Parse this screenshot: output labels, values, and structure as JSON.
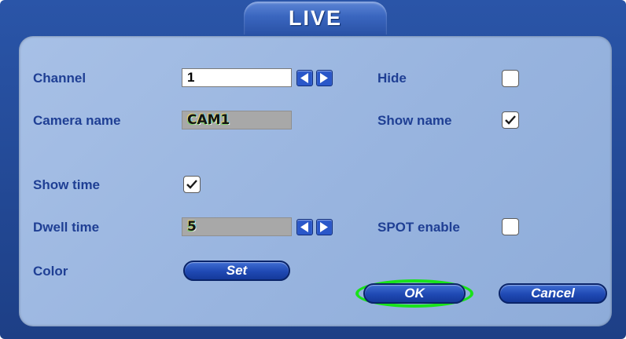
{
  "window": {
    "title": "LIVE"
  },
  "form": {
    "channel": {
      "label": "Channel",
      "value": "1"
    },
    "camera_name": {
      "label": "Camera name",
      "value": "CAM1"
    },
    "show_time": {
      "label": "Show time",
      "checked": true
    },
    "dwell_time": {
      "label": "Dwell time",
      "value": "5"
    },
    "color": {
      "label": "Color",
      "button": "Set"
    },
    "hide": {
      "label": "Hide",
      "checked": false
    },
    "show_name": {
      "label": "Show name",
      "checked": true
    },
    "spot_enable": {
      "label": "SPOT enable",
      "checked": false
    }
  },
  "buttons": {
    "ok": "OK",
    "cancel": "Cancel"
  },
  "colors": {
    "frame": "#1d3f86",
    "panel": "#98b4df",
    "label": "#1f3f94",
    "button": "#1f49b3",
    "focus_ring": "#19e21a"
  }
}
